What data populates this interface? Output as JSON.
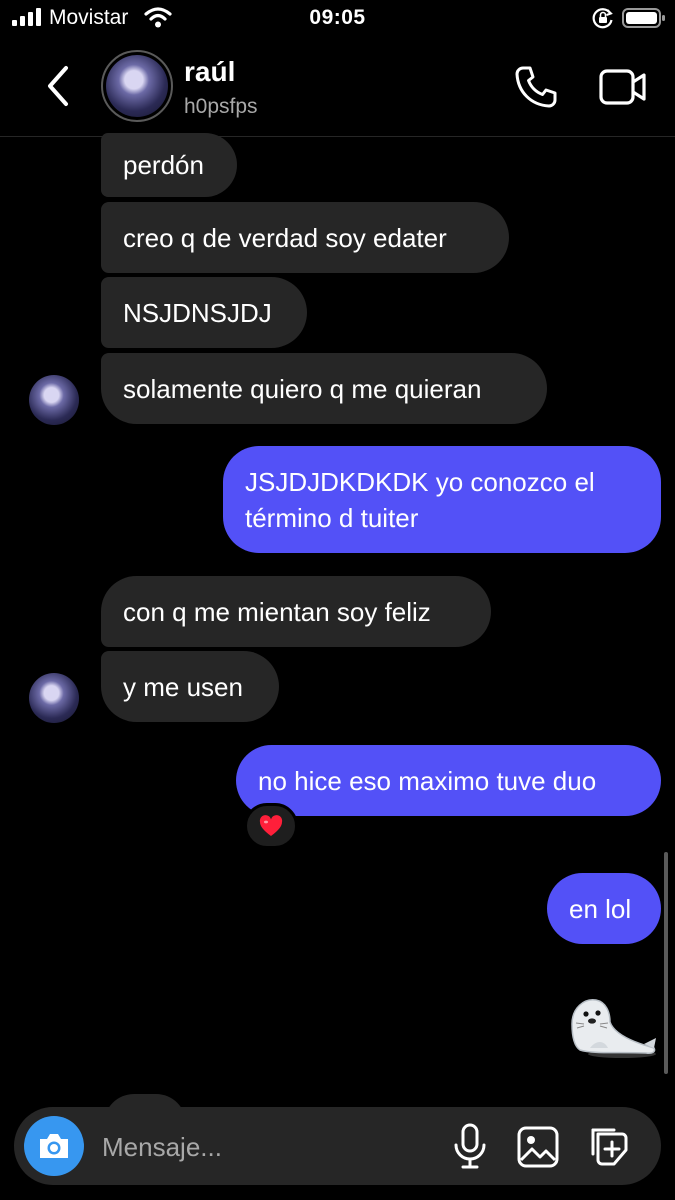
{
  "status_bar": {
    "carrier": "Movistar",
    "time": "09:05",
    "icons": [
      "signal-icon",
      "wifi-icon",
      "orientation-lock-icon",
      "battery-icon"
    ]
  },
  "header": {
    "contact_name": "raúl",
    "username": "h0psfps",
    "icons": [
      "back-icon",
      "phone-icon",
      "video-camera-icon"
    ]
  },
  "messages": [
    {
      "from": "them",
      "text": "perdón"
    },
    {
      "from": "them",
      "text": "creo q de verdad soy edater"
    },
    {
      "from": "them",
      "text": "NSJDNSJDJ"
    },
    {
      "from": "them",
      "text": "solamente quiero q me quieran"
    },
    {
      "from": "me",
      "text": "JSJDJDKDKDK yo conozco el término d tuiter"
    },
    {
      "from": "them",
      "text": "con q me mientan soy feliz"
    },
    {
      "from": "them",
      "text": "y me usen"
    },
    {
      "from": "me",
      "text": "no hice eso maximo tuve duo",
      "reaction": "❤️"
    },
    {
      "from": "me",
      "text": "en lol"
    },
    {
      "from": "me",
      "sticker": "seal-sticker"
    }
  ],
  "composer": {
    "placeholder": "Mensaje...",
    "icons": [
      "camera-icon",
      "microphone-icon",
      "gallery-icon",
      "sticker-icon"
    ]
  },
  "colors": {
    "background": "#000000",
    "incoming_bubble": "#262626",
    "outgoing_bubble": "#5351f7",
    "camera_button": "#3797f0",
    "secondary_text": "#a8a8a8"
  }
}
